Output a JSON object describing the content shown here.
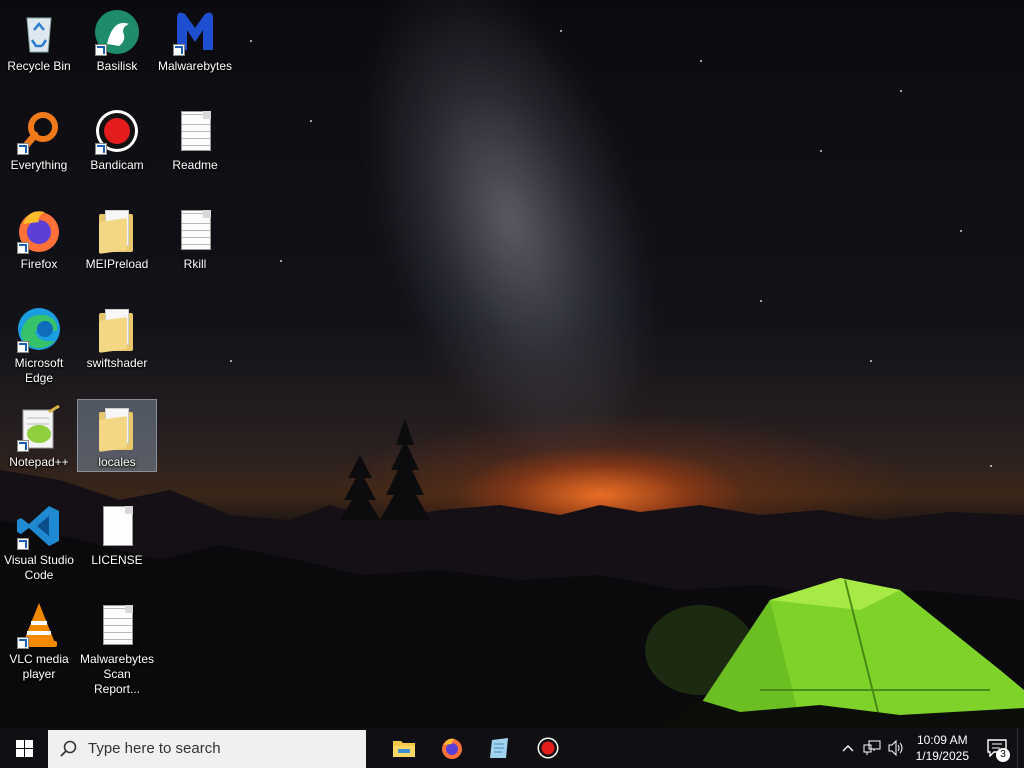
{
  "desktop": {
    "icons": [
      {
        "label": "Recycle Bin",
        "icon": "recycle-bin-icon"
      },
      {
        "label": "Basilisk",
        "icon": "basilisk-icon"
      },
      {
        "label": "Malwarebytes",
        "icon": "malwarebytes-icon"
      },
      {
        "label": "Everything",
        "icon": "everything-icon"
      },
      {
        "label": "Bandicam",
        "icon": "bandicam-icon"
      },
      {
        "label": "Readme",
        "icon": "document-icon"
      },
      {
        "label": "Firefox",
        "icon": "firefox-icon"
      },
      {
        "label": "MEIPreload",
        "icon": "folder-icon"
      },
      {
        "label": "Rkill",
        "icon": "document-icon"
      },
      {
        "label": "Microsoft Edge",
        "icon": "edge-icon"
      },
      {
        "label": "swiftshader",
        "icon": "folder-icon"
      },
      {
        "label": "Notepad++",
        "icon": "notepadpp-icon"
      },
      {
        "label": "locales",
        "icon": "folder-icon"
      },
      {
        "label": "Visual Studio Code",
        "icon": "vscode-icon"
      },
      {
        "label": "LICENSE",
        "icon": "blank-file-icon"
      },
      {
        "label": "VLC media player",
        "icon": "vlc-icon"
      },
      {
        "label": "Malwarebytes Scan Report...",
        "icon": "document-icon"
      }
    ],
    "selected_icon": "locales"
  },
  "taskbar": {
    "search_placeholder": "Type here to search",
    "pinned": [
      {
        "name": "File Explorer",
        "icon": "file-explorer-icon"
      },
      {
        "name": "Firefox",
        "icon": "firefox-icon"
      },
      {
        "name": "Notepad",
        "icon": "notepad-icon"
      },
      {
        "name": "Bandicam",
        "icon": "bandicam-icon"
      }
    ],
    "tray": {
      "time": "10:09 AM",
      "date": "1/19/2025",
      "notification_count": "3"
    }
  },
  "colors": {
    "taskbar_bg": "#101014",
    "tent_green": "#7fd22a",
    "selection": "#aac8e6"
  }
}
